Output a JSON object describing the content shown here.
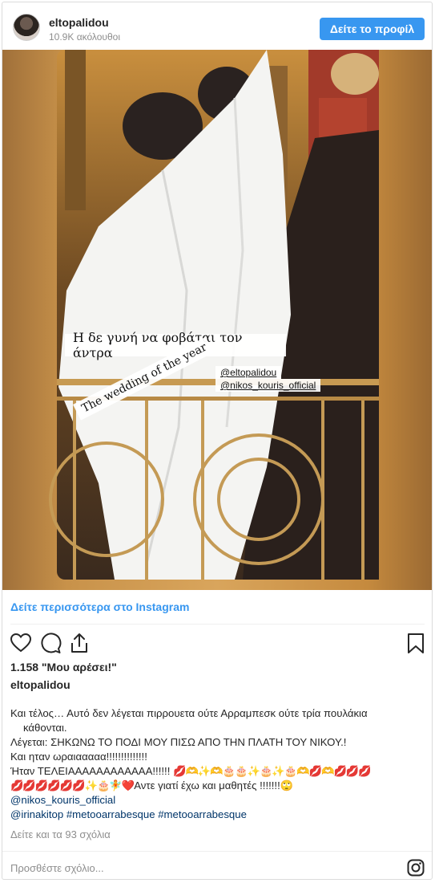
{
  "header": {
    "username": "eltopalidou",
    "followers": "10.9K ακόλουθοι",
    "profile_button": "Δείτε το προφίλ"
  },
  "media": {
    "overlay_caption": "Η δε γυνή να φοβάται τον άντρα",
    "mention_1": "@eltopalidou",
    "mention_2": "@nikos_kouris_official",
    "diagonal_label": "The wedding of the year"
  },
  "see_more": "Δείτε περισσότερα στο Instagram",
  "likes": "1.158 \"Μου αρέσει!\"",
  "post_username": "eltopalidou",
  "caption": {
    "line1": "Και τέλος… Αυτό δεν λέγεται πιρρουετα ούτε Αρραμπεσκ ούτε τρία πουλάκια",
    "line2": "κάθονται.",
    "line3": "Λέγεται: ΣΗΚΩΝΩ ΤΟ ΠΟΔΙ ΜΟΥ ΠΙΣΩ ΑΠΟ ΤΗΝ ΠΛΑΤΗ ΤΟΥ ΝΙΚΟΥ.!",
    "line4": "Και ηταν ωραιααααα!!!!!!!!!!!!!!",
    "line5_text": "Ήταν ΤΕΛΕΙΑΑΑΑΑΑΑΑΑΑΑΑ!!!!!!",
    "line5_emojis": "💋🫶✨🫶🎂🎂✨🎂✨🎂🫶💋🫶💋💋💋",
    "line6_emojis": "💋💋💋💋💋💋✨🎂🧚❤️",
    "line6_text": "Αντε γιατί έχω και μαθητές !!!!!!!🙄",
    "tag1": "@nikos_kouris_official",
    "tag2": "@irinakitop",
    "hashtag1": "#metooarrabesque",
    "hashtag2": "#metooarrabesque"
  },
  "comments_link": "Δείτε και τα 93 σχόλια",
  "add_comment_placeholder": "Προσθέστε σχόλιο...",
  "icons": {
    "like": "heart-icon",
    "comment": "comment-icon",
    "share": "share-icon",
    "save": "bookmark-icon",
    "instagram": "instagram-icon"
  },
  "colors": {
    "accent": "#3897f0",
    "link": "#003569",
    "muted": "#8e8e8e",
    "text": "#262626"
  }
}
